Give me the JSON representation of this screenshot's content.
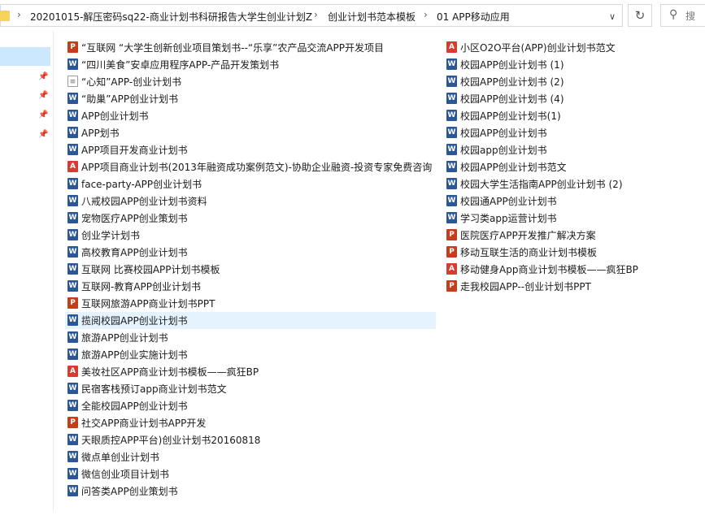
{
  "address": {
    "crumbs": [
      "20201015-解压密码sq22-商业计划书科研报告大学生创业计划Z",
      "创业计划书范本模板",
      "01 APP移动应用"
    ],
    "separator": "›",
    "dropdown_glyph": "∨",
    "refresh_glyph": "↻"
  },
  "search": {
    "placeholder": "搜"
  },
  "colors": {
    "selection": "#cce8ff",
    "hover": "#e5f3ff",
    "word": "#2b5797",
    "pdf": "#d83b2f",
    "ppt": "#c43e1c"
  },
  "files": {
    "column1": [
      {
        "name": "“互联网 “大学生创新创业项目策划书--“乐享”农产品交流APP开发项目",
        "icon": "ppt-icon"
      },
      {
        "name": "“四川美食”安卓应用程序APP-产品开发策划书",
        "icon": "word-icon"
      },
      {
        "name": "“心知”APP-创业计划书",
        "icon": "text-icon"
      },
      {
        "name": "“助巢”APP创业计划书",
        "icon": "word-icon"
      },
      {
        "name": "APP创业计划书",
        "icon": "word-icon"
      },
      {
        "name": "APP划书",
        "icon": "word-icon"
      },
      {
        "name": "APP项目开发商业计划书",
        "icon": "word-icon"
      },
      {
        "name": "APP项目商业计划书(2013年融资成功案例范文)-协助企业融资-投资专家免费咨询",
        "icon": "pdf-icon"
      },
      {
        "name": "face-party-APP创业计划书",
        "icon": "word-icon"
      },
      {
        "name": "八戒校园APP创业计划书资料",
        "icon": "word-icon"
      },
      {
        "name": "宠物医疗APP创业策划书",
        "icon": "word-icon"
      },
      {
        "name": "创业学计划书",
        "icon": "word-icon"
      },
      {
        "name": "高校教育APP创业计划书",
        "icon": "word-icon"
      },
      {
        "name": "互联网 比赛校园APP计划书模板",
        "icon": "word-icon"
      },
      {
        "name": "互联网-教育APP创业计划书",
        "icon": "word-icon"
      },
      {
        "name": "互联网旅游APP商业计划书PPT",
        "icon": "ppt-icon"
      },
      {
        "name": "揽阅校园APP创业计划书",
        "icon": "word-icon"
      },
      {
        "name": "旅游APP创业计划书",
        "icon": "word-icon"
      },
      {
        "name": "旅游APP创业实施计划书",
        "icon": "word-icon"
      },
      {
        "name": "美妆社区APP商业计划书模板——疯狂BP",
        "icon": "pdf-icon"
      },
      {
        "name": "民宿客栈预订app商业计划书范文",
        "icon": "word-icon"
      },
      {
        "name": "全能校园APP创业计划书",
        "icon": "word-icon"
      },
      {
        "name": "社交APP商业计划书APP开发",
        "icon": "ppt-icon"
      },
      {
        "name": "天眼质控APP平台)创业计划书20160818",
        "icon": "word-icon"
      },
      {
        "name": "微点单创业计划书",
        "icon": "word-icon"
      },
      {
        "name": "微信创业项目计划书",
        "icon": "word-icon"
      },
      {
        "name": "问答类APP创业策划书",
        "icon": "word-icon"
      }
    ],
    "column2": [
      {
        "name": "小区O2O平台(APP)创业计划书范文",
        "icon": "pdf-icon"
      },
      {
        "name": "校园APP创业计划书 (1)",
        "icon": "word-icon"
      },
      {
        "name": "校园APP创业计划书 (2)",
        "icon": "word-icon"
      },
      {
        "name": "校园APP创业计划书 (4)",
        "icon": "word-icon"
      },
      {
        "name": "校园APP创业计划书(1)",
        "icon": "word-icon"
      },
      {
        "name": "校园APP创业计划书",
        "icon": "word-icon"
      },
      {
        "name": "校园app创业计划书",
        "icon": "word-icon"
      },
      {
        "name": "校园APP创业计划书范文",
        "icon": "word-icon"
      },
      {
        "name": "校园大学生活指南APP创业计划书 (2)",
        "icon": "word-icon"
      },
      {
        "name": "校园通APP创业计划书",
        "icon": "word-icon"
      },
      {
        "name": "学习类app运营计划书",
        "icon": "word-icon"
      },
      {
        "name": "医院医疗APP开发推广解决方案",
        "icon": "ppt-icon"
      },
      {
        "name": "移动互联生活的商业计划书模板",
        "icon": "ppt-icon"
      },
      {
        "name": "移动健身App商业计划书模板——疯狂BP",
        "icon": "pdf-icon"
      },
      {
        "name": "走我校园APP--创业计划书PPT",
        "icon": "ppt-icon"
      }
    ]
  }
}
